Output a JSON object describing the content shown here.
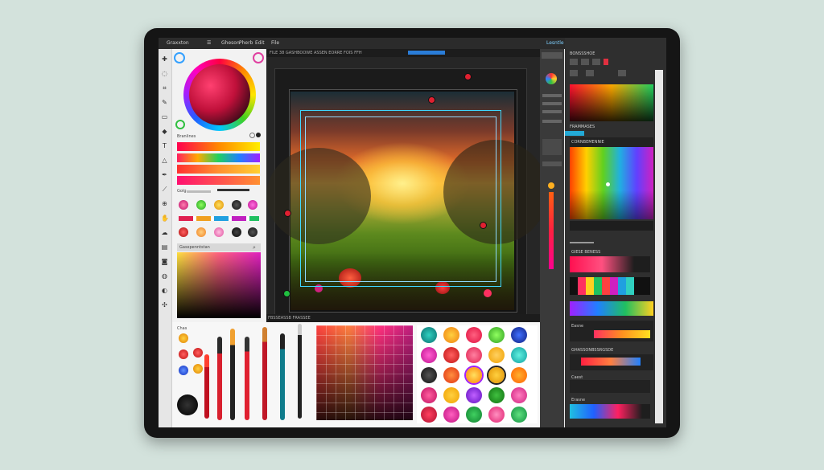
{
  "menu": {
    "app_title": "Graxxton",
    "items": [
      "☰",
      "Gheson",
      "Pherb",
      "Edit",
      "File"
    ],
    "status_label": "Lesntle"
  },
  "left_panel": {
    "gradients_label": "Branlines",
    "opacity_label": "Golg",
    "gradient_box_label": "Gasxpenntstan",
    "tools_label": "Chas"
  },
  "canvas": {
    "toolbar_text": "FILE 38 GASHBOOWE ASSEN EORRE FOIS FFH",
    "footer_text": "FBSSEASSB FRASSEE"
  },
  "right_panel": {
    "header_1": "BONSSSHOE",
    "header_2": "FRAMMASES",
    "spectrum_label": "CORNBEMENNIE",
    "section_label": "GIESE BENESS",
    "layers_label": "GHASSONBSSRGSDE",
    "accent_button": "BRASE",
    "swatch_labels": [
      "Easne",
      "Caest",
      "Erasne"
    ]
  },
  "colors": {
    "accent": "#23a9d6",
    "handle": "#e02030",
    "brush_red": "#d8202e",
    "brush_teal": "#0f7c8c"
  }
}
